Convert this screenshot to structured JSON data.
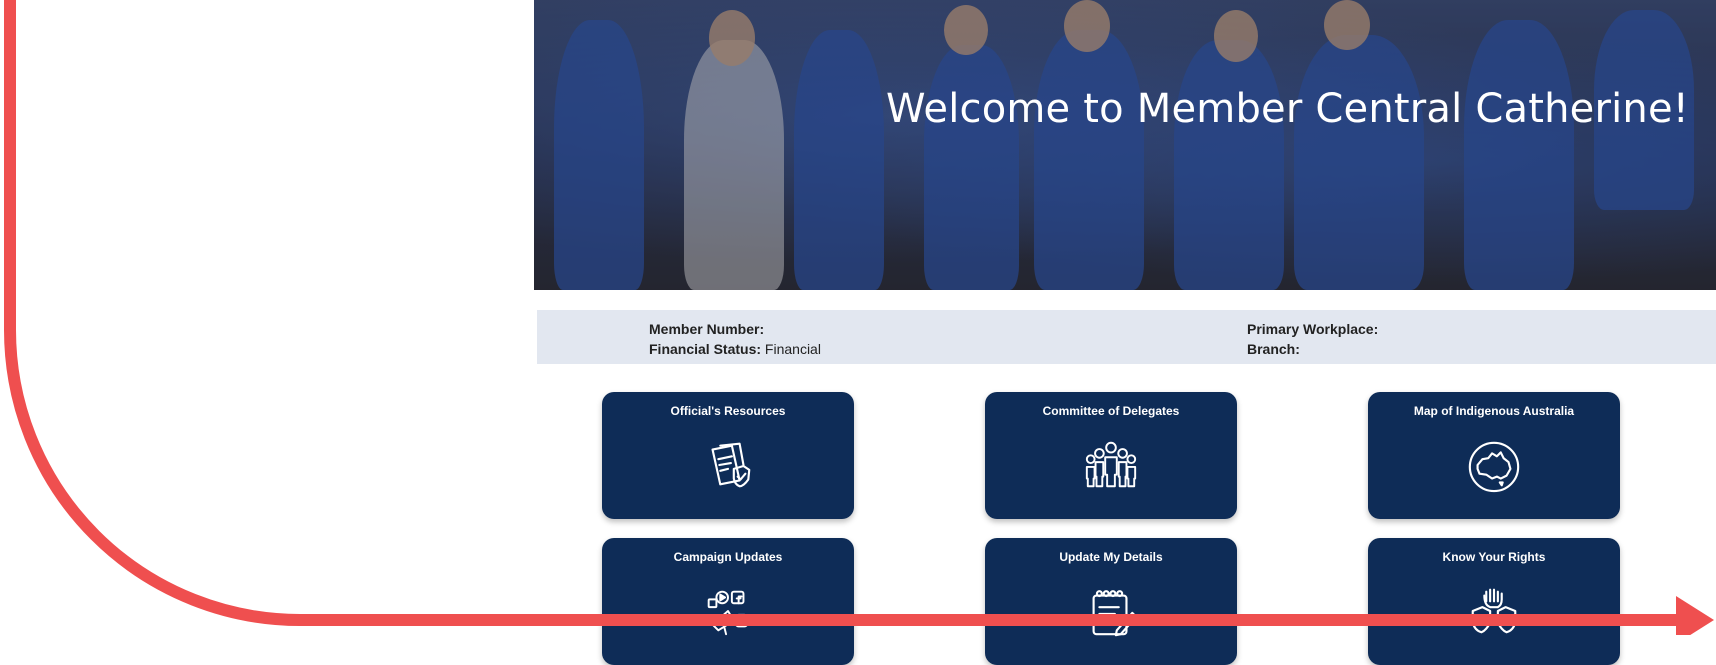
{
  "hero": {
    "title": "Welcome to Member Central Catherine!"
  },
  "member_info": {
    "member_number_label": "Member Number:",
    "member_number_value": "",
    "financial_status_label": "Financial Status:",
    "financial_status_value": "Financial",
    "primary_workplace_label": "Primary Workplace:",
    "primary_workplace_value": "",
    "branch_label": "Branch:",
    "branch_value": ""
  },
  "tiles": [
    {
      "label": "Official's Resources",
      "icon": "document-shield-icon"
    },
    {
      "label": "Committee of Delegates",
      "icon": "group-people-icon"
    },
    {
      "label": "Map of Indigenous Australia",
      "icon": "australia-map-icon"
    },
    {
      "label": "Campaign Updates",
      "icon": "social-media-icon"
    },
    {
      "label": "Update My Details",
      "icon": "notepad-pen-icon"
    },
    {
      "label": "Know Your Rights",
      "icon": "fist-shields-icon"
    }
  ],
  "colors": {
    "tile_bg": "#0e2c57",
    "info_bar_bg": "#e2e7f0",
    "annotation_arrow": "#ef4f4f"
  }
}
